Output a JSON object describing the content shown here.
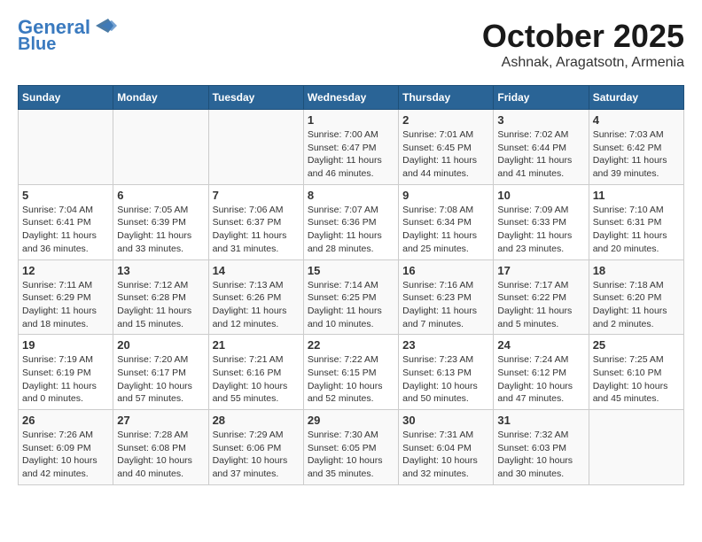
{
  "header": {
    "logo_line1": "General",
    "logo_line2": "Blue",
    "title": "October 2025",
    "subtitle": "Ashnak, Aragatsotn, Armenia"
  },
  "calendar": {
    "days_of_week": [
      "Sunday",
      "Monday",
      "Tuesday",
      "Wednesday",
      "Thursday",
      "Friday",
      "Saturday"
    ],
    "weeks": [
      [
        {
          "day": "",
          "info": ""
        },
        {
          "day": "",
          "info": ""
        },
        {
          "day": "",
          "info": ""
        },
        {
          "day": "1",
          "info": "Sunrise: 7:00 AM\nSunset: 6:47 PM\nDaylight: 11 hours\nand 46 minutes."
        },
        {
          "day": "2",
          "info": "Sunrise: 7:01 AM\nSunset: 6:45 PM\nDaylight: 11 hours\nand 44 minutes."
        },
        {
          "day": "3",
          "info": "Sunrise: 7:02 AM\nSunset: 6:44 PM\nDaylight: 11 hours\nand 41 minutes."
        },
        {
          "day": "4",
          "info": "Sunrise: 7:03 AM\nSunset: 6:42 PM\nDaylight: 11 hours\nand 39 minutes."
        }
      ],
      [
        {
          "day": "5",
          "info": "Sunrise: 7:04 AM\nSunset: 6:41 PM\nDaylight: 11 hours\nand 36 minutes."
        },
        {
          "day": "6",
          "info": "Sunrise: 7:05 AM\nSunset: 6:39 PM\nDaylight: 11 hours\nand 33 minutes."
        },
        {
          "day": "7",
          "info": "Sunrise: 7:06 AM\nSunset: 6:37 PM\nDaylight: 11 hours\nand 31 minutes."
        },
        {
          "day": "8",
          "info": "Sunrise: 7:07 AM\nSunset: 6:36 PM\nDaylight: 11 hours\nand 28 minutes."
        },
        {
          "day": "9",
          "info": "Sunrise: 7:08 AM\nSunset: 6:34 PM\nDaylight: 11 hours\nand 25 minutes."
        },
        {
          "day": "10",
          "info": "Sunrise: 7:09 AM\nSunset: 6:33 PM\nDaylight: 11 hours\nand 23 minutes."
        },
        {
          "day": "11",
          "info": "Sunrise: 7:10 AM\nSunset: 6:31 PM\nDaylight: 11 hours\nand 20 minutes."
        }
      ],
      [
        {
          "day": "12",
          "info": "Sunrise: 7:11 AM\nSunset: 6:29 PM\nDaylight: 11 hours\nand 18 minutes."
        },
        {
          "day": "13",
          "info": "Sunrise: 7:12 AM\nSunset: 6:28 PM\nDaylight: 11 hours\nand 15 minutes."
        },
        {
          "day": "14",
          "info": "Sunrise: 7:13 AM\nSunset: 6:26 PM\nDaylight: 11 hours\nand 12 minutes."
        },
        {
          "day": "15",
          "info": "Sunrise: 7:14 AM\nSunset: 6:25 PM\nDaylight: 11 hours\nand 10 minutes."
        },
        {
          "day": "16",
          "info": "Sunrise: 7:16 AM\nSunset: 6:23 PM\nDaylight: 11 hours\nand 7 minutes."
        },
        {
          "day": "17",
          "info": "Sunrise: 7:17 AM\nSunset: 6:22 PM\nDaylight: 11 hours\nand 5 minutes."
        },
        {
          "day": "18",
          "info": "Sunrise: 7:18 AM\nSunset: 6:20 PM\nDaylight: 11 hours\nand 2 minutes."
        }
      ],
      [
        {
          "day": "19",
          "info": "Sunrise: 7:19 AM\nSunset: 6:19 PM\nDaylight: 11 hours\nand 0 minutes."
        },
        {
          "day": "20",
          "info": "Sunrise: 7:20 AM\nSunset: 6:17 PM\nDaylight: 10 hours\nand 57 minutes."
        },
        {
          "day": "21",
          "info": "Sunrise: 7:21 AM\nSunset: 6:16 PM\nDaylight: 10 hours\nand 55 minutes."
        },
        {
          "day": "22",
          "info": "Sunrise: 7:22 AM\nSunset: 6:15 PM\nDaylight: 10 hours\nand 52 minutes."
        },
        {
          "day": "23",
          "info": "Sunrise: 7:23 AM\nSunset: 6:13 PM\nDaylight: 10 hours\nand 50 minutes."
        },
        {
          "day": "24",
          "info": "Sunrise: 7:24 AM\nSunset: 6:12 PM\nDaylight: 10 hours\nand 47 minutes."
        },
        {
          "day": "25",
          "info": "Sunrise: 7:25 AM\nSunset: 6:10 PM\nDaylight: 10 hours\nand 45 minutes."
        }
      ],
      [
        {
          "day": "26",
          "info": "Sunrise: 7:26 AM\nSunset: 6:09 PM\nDaylight: 10 hours\nand 42 minutes."
        },
        {
          "day": "27",
          "info": "Sunrise: 7:28 AM\nSunset: 6:08 PM\nDaylight: 10 hours\nand 40 minutes."
        },
        {
          "day": "28",
          "info": "Sunrise: 7:29 AM\nSunset: 6:06 PM\nDaylight: 10 hours\nand 37 minutes."
        },
        {
          "day": "29",
          "info": "Sunrise: 7:30 AM\nSunset: 6:05 PM\nDaylight: 10 hours\nand 35 minutes."
        },
        {
          "day": "30",
          "info": "Sunrise: 7:31 AM\nSunset: 6:04 PM\nDaylight: 10 hours\nand 32 minutes."
        },
        {
          "day": "31",
          "info": "Sunrise: 7:32 AM\nSunset: 6:03 PM\nDaylight: 10 hours\nand 30 minutes."
        },
        {
          "day": "",
          "info": ""
        }
      ]
    ]
  }
}
